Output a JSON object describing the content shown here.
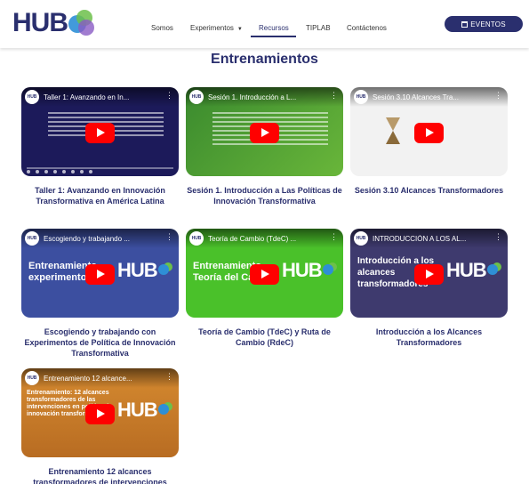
{
  "brand": {
    "logo_text": "HUB"
  },
  "nav": {
    "items": [
      "Somos",
      "Experimentos",
      "Recursos",
      "TIPLAB",
      "Contáctenos"
    ],
    "active": "Recursos"
  },
  "eventos_label": "EVENTOS",
  "section_title": "Entrenamientos",
  "colors": {
    "primary": "#2a2f6e",
    "play_red": "#ff0000"
  },
  "videos": [
    {
      "thumb_title": "Taller 1: Avanzando en In...",
      "title": "Taller 1: Avanzando en Innovación Transformativa en América Latina"
    },
    {
      "thumb_title": "Sesión 1. Introducción a L...",
      "title": "Sesión 1. Introducción a Las Políticas de Innovación Transformativa"
    },
    {
      "thumb_title": "Sesión 3.10 Alcances Tra...",
      "title": "Sesión 3.10 Alcances Transformadores"
    },
    {
      "thumb_title": "Escogiendo y trabajando ...",
      "thumb_big": "Entrenamiento experimentos",
      "title": "Escogiendo y trabajando con Experimentos de Política de Innovación Transformativa"
    },
    {
      "thumb_title": "Teoría de Cambio (TdeC) ...",
      "thumb_big": "Entrenamiento Teoría del Cambio",
      "title": "Teoría de Cambio (TdeC) y Ruta de Cambio (RdeC)"
    },
    {
      "thumb_title": "INTRODUCCIÓN A LOS AL...",
      "thumb_big": "Introducción a los alcances transformadores",
      "title": "Introducción a los Alcances Transformadores"
    },
    {
      "thumb_title": "Entrenamiento 12 alcance...",
      "thumb_big": "Entrenamiento: 12 alcances transformadores de las intervenciones en política de innovación transformativa",
      "title": "Entrenamiento 12 alcances transformadores de intervenciones"
    }
  ]
}
